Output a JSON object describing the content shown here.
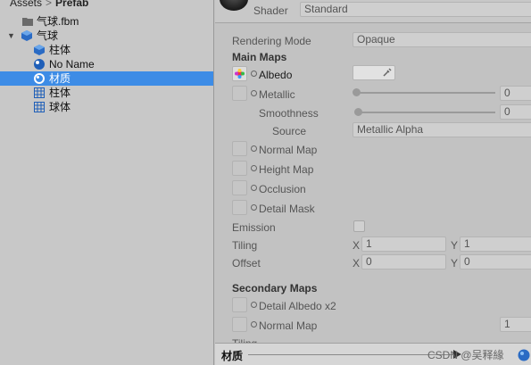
{
  "project": {
    "breadcrumb": [
      "Assets",
      "Prefab"
    ],
    "items": [
      {
        "label": "气球.fbm",
        "icon": "folder-icon"
      },
      {
        "label": "气球",
        "icon": "prefab-icon"
      },
      {
        "label": "柱体",
        "icon": "mesh-prefab-icon"
      },
      {
        "label": "No Name",
        "icon": "material-icon"
      },
      {
        "label": "材质",
        "icon": "material-icon",
        "selected": true
      },
      {
        "label": "柱体",
        "icon": "mesh-icon"
      },
      {
        "label": "球体",
        "icon": "mesh-icon"
      }
    ]
  },
  "inspector": {
    "shader_label": "Shader",
    "shader_value": "Standard",
    "rendering_mode_label": "Rendering Mode",
    "rendering_mode_value": "Opaque",
    "main_maps_heading": "Main Maps",
    "albedo_label": "Albedo",
    "metallic_label": "Metallic",
    "metallic_value": "0",
    "smoothness_label": "Smoothness",
    "smoothness_value": "0",
    "source_label": "Source",
    "source_value": "Metallic Alpha",
    "normal_map_label": "Normal Map",
    "height_map_label": "Height Map",
    "occlusion_label": "Occlusion",
    "detail_mask_label": "Detail Mask",
    "emission_label": "Emission",
    "tiling_label": "Tiling",
    "tiling_x": "1",
    "tiling_y": "1",
    "offset_label": "Offset",
    "offset_x": "0",
    "offset_y": "0",
    "x_label": "X",
    "y_label": "Y",
    "secondary_maps_heading": "Secondary Maps",
    "detail_albedo_label": "Detail Albedo x2",
    "secondary_normal_map_label": "Normal Map",
    "secondary_normal_value": "1",
    "tiling_partial_label": "Tiling"
  },
  "preview": {
    "name": "材质"
  },
  "watermark": "CSDN @吴释緣"
}
